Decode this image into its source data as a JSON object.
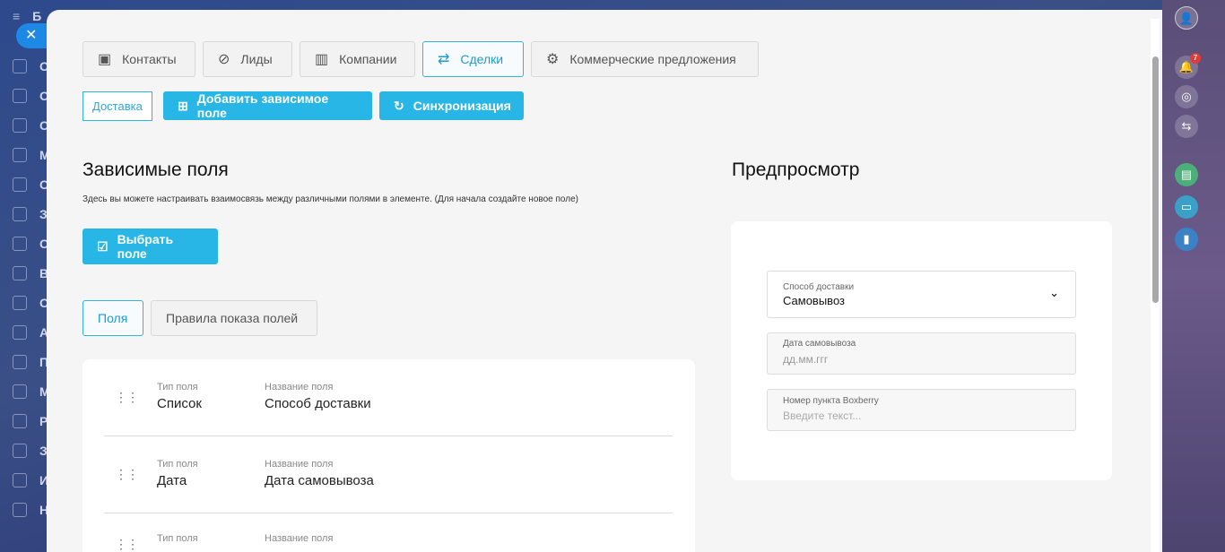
{
  "sidebar": {
    "title": "Б",
    "items": [
      "С",
      "О",
      "С",
      "М",
      "С",
      "З",
      "С",
      "В",
      "С",
      "А",
      "П",
      "М",
      "Р",
      "З",
      "И",
      "Н"
    ]
  },
  "close_label": "✕",
  "right_rail": {
    "notifications_count": "7"
  },
  "tabs": [
    {
      "label": "Контакты",
      "icon": "contact-icon"
    },
    {
      "label": "Лиды",
      "icon": "magnet-icon"
    },
    {
      "label": "Компании",
      "icon": "building-icon"
    },
    {
      "label": "Сделки",
      "icon": "swap-icon"
    },
    {
      "label": "Коммерческие предложения",
      "icon": "gear-icon"
    }
  ],
  "toolbar": {
    "delivery": "Доставка",
    "add_field": "Добавить зависимое поле",
    "sync": "Синхронизация"
  },
  "main": {
    "title": "Зависимые поля",
    "description": "Здесь вы можете настраивать взаимосвязь между различными полями в элементе. (Для начала создайте новое поле)",
    "select_field": "Выбрать поле",
    "subtabs": [
      "Поля",
      "Правила показа полей"
    ],
    "fields": [
      {
        "type_label": "Тип поля",
        "type": "Список",
        "name_label": "Название поля",
        "name": "Способ доставки"
      },
      {
        "type_label": "Тип поля",
        "type": "Дата",
        "name_label": "Название поля",
        "name": "Дата самовывоза"
      },
      {
        "type_label": "Тип поля",
        "type": "",
        "name_label": "Название поля",
        "name": ""
      }
    ]
  },
  "preview": {
    "title": "Предпросмотр",
    "fields": [
      {
        "label": "Способ доставки",
        "value": "Самовывоз"
      },
      {
        "label": "Дата самовывоза",
        "placeholder": "дд.мм.ггг"
      },
      {
        "label": "Номер пункта Boxberry",
        "placeholder": "Введите текст..."
      }
    ]
  }
}
